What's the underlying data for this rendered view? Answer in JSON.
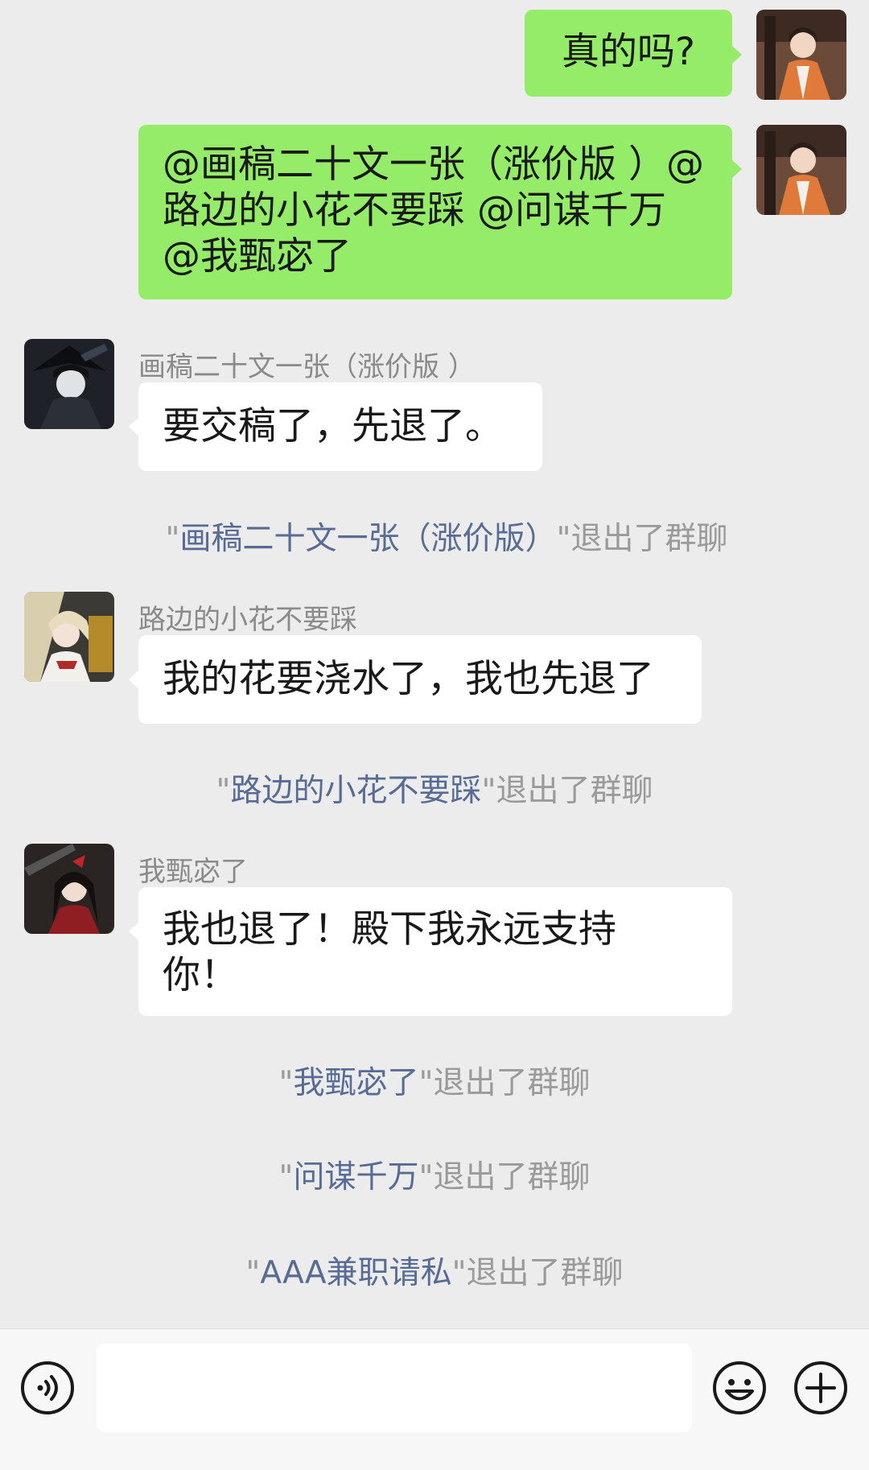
{
  "messages": [
    {
      "type": "out",
      "text": "真的吗?"
    },
    {
      "type": "out",
      "text": "@画稿二十文一张（涨价版 ）@路边的小花不要踩 @问谋千万 @我甄宓了"
    },
    {
      "type": "in",
      "sender": "画稿二十文一张（涨价版 ）",
      "text": "要交稿了，先退了。"
    },
    {
      "type": "system",
      "quote_open": "\"",
      "name": "画稿二十文一张（涨价版）",
      "quote_close": "\"",
      "suffix": "退出了群聊"
    },
    {
      "type": "in",
      "sender": "路边的小花不要踩",
      "text": "我的花要浇水了，我也先退了"
    },
    {
      "type": "system",
      "quote_open": "\"",
      "name": "路边的小花不要踩",
      "quote_close": "\"",
      "suffix": "退出了群聊"
    },
    {
      "type": "in",
      "sender": "我甄宓了",
      "text": "我也退了！殿下我永远支持你！"
    },
    {
      "type": "system",
      "quote_open": "\"",
      "name": "我甄宓了",
      "quote_close": "\"",
      "suffix": "退出了群聊"
    },
    {
      "type": "system",
      "quote_open": "\"",
      "name": "问谋千万",
      "quote_close": "\"",
      "suffix": "退出了群聊"
    },
    {
      "type": "system",
      "quote_open": "\"",
      "name": "AAA兼职请私",
      "quote_close": "\"",
      "suffix": "退出了群聊"
    }
  ],
  "input_bar": {
    "voice_icon": "voice-icon",
    "emoji_icon": "emoji-icon",
    "plus_icon": "plus-icon",
    "input_value": ""
  },
  "colors": {
    "background": "#ececec",
    "outgoing_bubble": "#95ec69",
    "incoming_bubble": "#ffffff",
    "system_name": "#576b95",
    "system_text": "#9a9a9a"
  }
}
